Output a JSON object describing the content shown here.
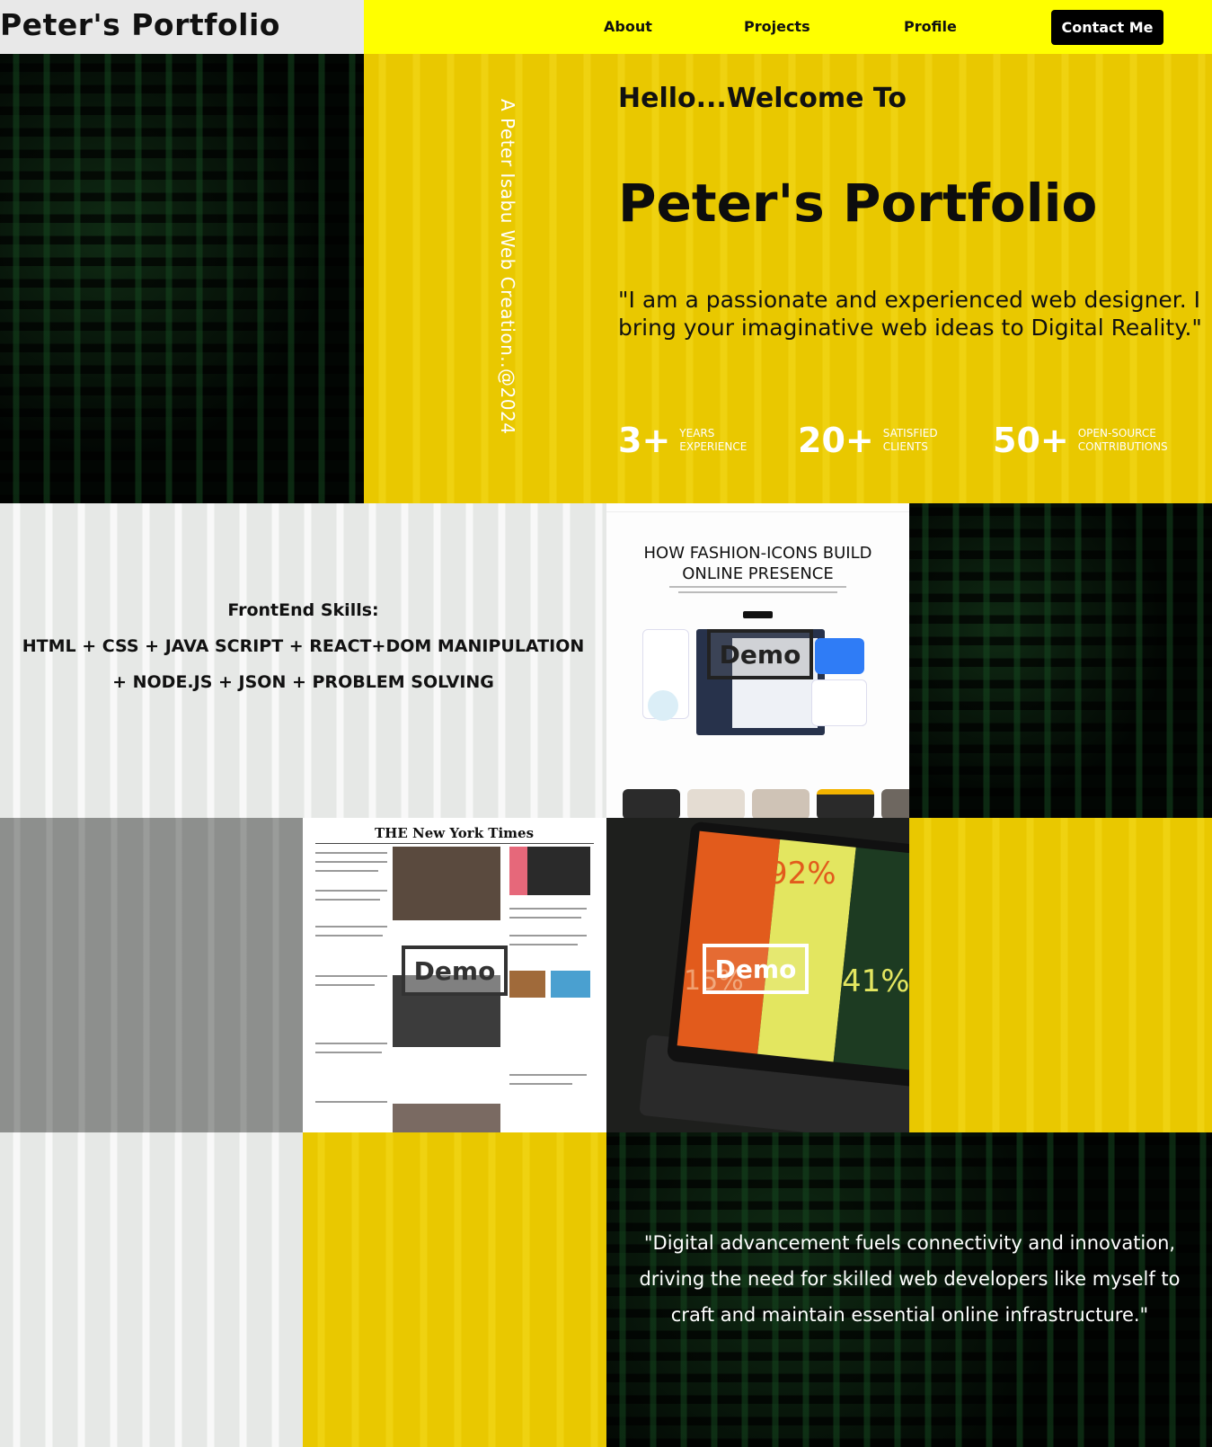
{
  "nav": {
    "brand": "Peter's Portfolio",
    "links": [
      "About",
      "Projects",
      "Profile"
    ],
    "contact": "Contact Me"
  },
  "hero": {
    "vertical_caption": "A Peter Isabu Web Creation..@2024",
    "greeting": "Hello...Welcome To",
    "title": "Peter's Portfolio",
    "quote": "\"I am a passionate and experienced web designer. I bring your imaginative web ideas to Digital Reality.\"",
    "stats": [
      {
        "value": "3+",
        "label_line1": "YEARS",
        "label_line2": "EXPERIENCE"
      },
      {
        "value": "20+",
        "label_line1": "SATISFIED",
        "label_line2": "CLIENTS"
      },
      {
        "value": "50+",
        "label_line1": "OPEN-SOURCE",
        "label_line2": "CONTRIBUTIONS"
      }
    ]
  },
  "skills": {
    "title": "FrontEnd Skills:",
    "line1": "HTML + CSS + JAVA SCRIPT + REACT+DOM MANIPULATION",
    "line2": "+ NODE.JS + JSON + PROBLEM SOLVING"
  },
  "projects": [
    {
      "heading_line1": "HOW FASHION-ICONS BUILD",
      "heading_line2": "ONLINE PRESENCE",
      "demo": "Demo"
    },
    {
      "masthead": "THE New York Times",
      "demo": "Demo"
    },
    {
      "stat1": "92%",
      "stat2": "41%",
      "stat3": "15%",
      "demo": "Demo"
    }
  ],
  "closing": {
    "quote": "\"Digital advancement fuels connectivity and innovation, driving the need for skilled web developers like myself to craft and maintain essential online infrastructure.\""
  },
  "colors": {
    "nav_yellow": "#ffff00",
    "panel_yellow": "#e9c800",
    "matrix_green": "#14461e",
    "button_black": "#000000"
  }
}
